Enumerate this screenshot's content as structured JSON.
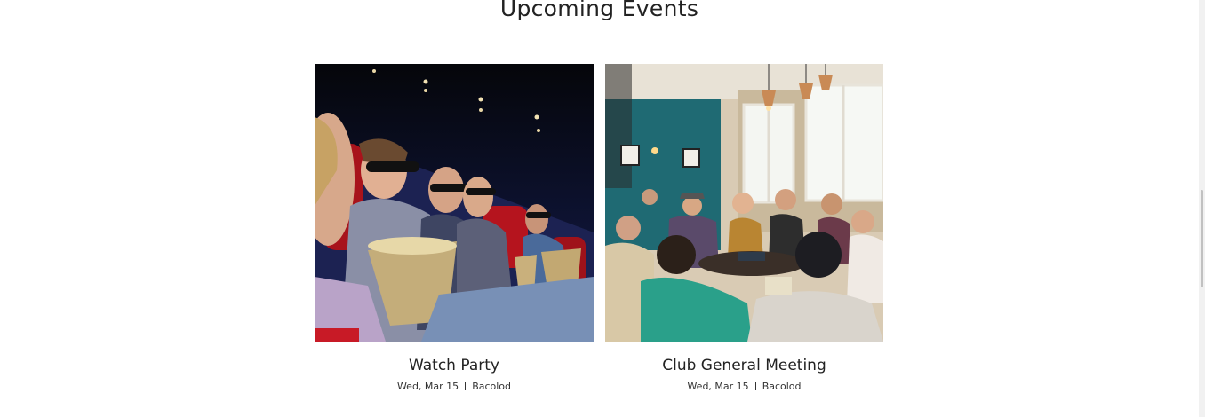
{
  "section": {
    "title": "Upcoming Events"
  },
  "events": [
    {
      "title": "Watch Party",
      "date": "Wed, Mar 15",
      "location": "Bacolod",
      "image": "movie-theater-audience-photo"
    },
    {
      "title": "Club General Meeting",
      "date": "Wed, Mar 15",
      "location": "Bacolod",
      "image": "group-meeting-cafe-photo"
    }
  ]
}
